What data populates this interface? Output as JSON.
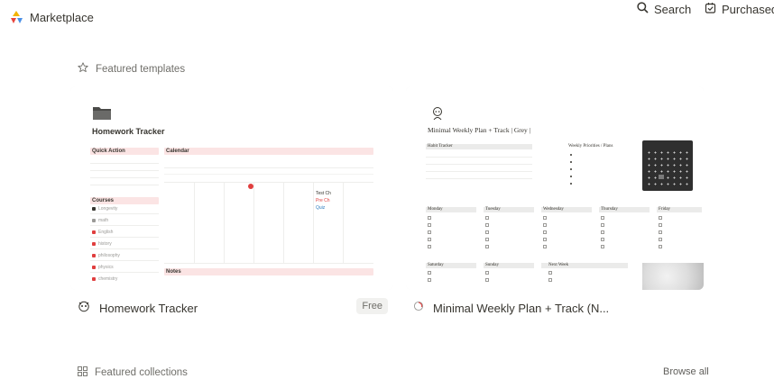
{
  "header": {
    "brand": "Marketplace",
    "search_label": "Search",
    "purchased_label": "Purchased"
  },
  "featured_templates": {
    "heading": "Featured templates",
    "cards": [
      {
        "title": "Homework Tracker",
        "price": "Free",
        "preview": {
          "page_title": "Homework Tracker",
          "quick_action": "Quick Action",
          "calendar": "Calendar",
          "courses": "Courses",
          "notes": "Notes",
          "course_items": [
            "Longevity",
            "math",
            "English",
            "history",
            "philosophy",
            "physics",
            "chemistry"
          ],
          "calendar_event": [
            "Test Ch",
            "Pre Ch",
            "Quiz"
          ]
        }
      },
      {
        "title": "Minimal Weekly Plan + Track (N...",
        "preview": {
          "page_title": "Minimal Weekly Plan + Track | Grey |",
          "habit_tracker": "Habit Tracker",
          "weekly_priorities": "Weekly Priorities / Plans",
          "days": [
            "Monday",
            "Tuesday",
            "Wednesday",
            "Thursday",
            "Friday"
          ],
          "days_row2": [
            "Saturday",
            "Sunday",
            "Next Week"
          ]
        }
      }
    ]
  },
  "featured_collections": {
    "heading": "Featured collections",
    "browse_all": "Browse all"
  },
  "colors": {
    "accent_pink": "#fbe4e4",
    "text": "#37352f",
    "muted": "#6f6e69"
  },
  "icons": {
    "logo": "marketplace-logo",
    "search": "search-icon",
    "purchased": "purchased-icon",
    "star": "star-icon",
    "grid": "grid-icon"
  }
}
